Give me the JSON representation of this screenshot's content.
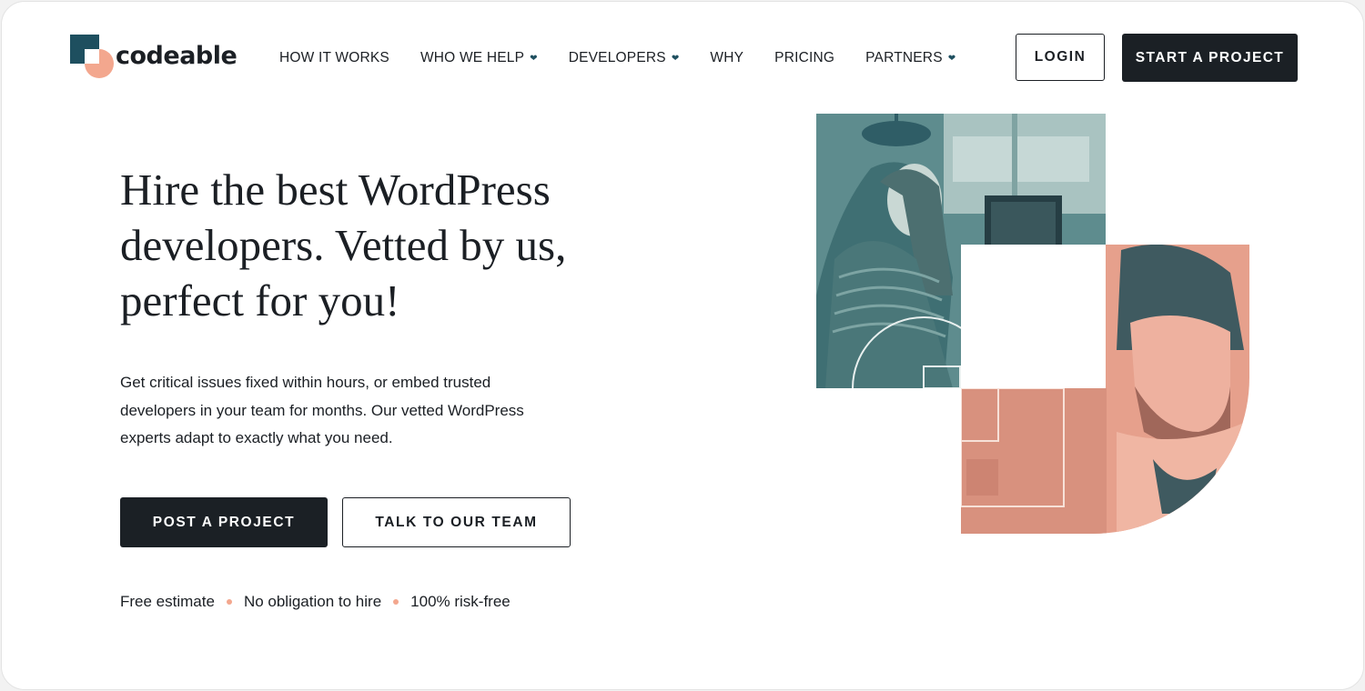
{
  "brand": {
    "name": "codeable",
    "colors": {
      "teal": "#1e4f5f",
      "peach": "#f3a78e",
      "dark": "#1b2025"
    }
  },
  "nav": {
    "items": [
      {
        "label": "HOW IT WORKS",
        "dropdown": false
      },
      {
        "label": "WHO WE HELP",
        "dropdown": true
      },
      {
        "label": "DEVELOPERS",
        "dropdown": true
      },
      {
        "label": "WHY",
        "dropdown": false
      },
      {
        "label": "PRICING",
        "dropdown": false
      },
      {
        "label": "PARTNERS",
        "dropdown": true
      }
    ],
    "login_label": "LOGIN",
    "start_label": "START A PROJECT"
  },
  "hero": {
    "headline_lines": [
      "Hire the best WordPress",
      "developers. Vetted by us,",
      "perfect for you!"
    ],
    "subtext_lines": [
      "Get critical issues fixed within hours, or embed trusted",
      "developers in your team for months. Our vetted WordPress",
      "experts adapt to exactly what you need."
    ],
    "primary_cta": "POST A PROJECT",
    "secondary_cta": "TALK TO OUR TEAM",
    "perks": [
      "Free estimate",
      "No obligation to hire",
      "100% risk-free"
    ]
  },
  "illustration": {
    "photos": [
      "woman-with-laptop-photo",
      "man-with-beard-photo"
    ],
    "tints": {
      "photo_1": "#4e7d80",
      "photo_2": "#e59c86"
    }
  }
}
